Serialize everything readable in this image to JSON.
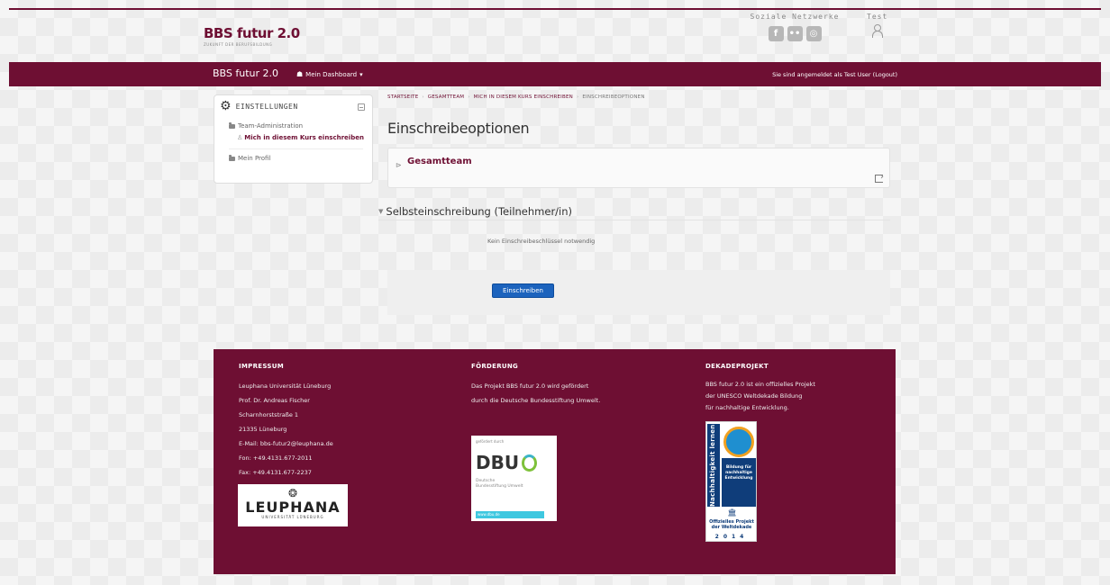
{
  "header": {
    "brand": "BBS futur 2.0",
    "brand_sub": "ZUKUNFT DER BERUFSBILDUNG",
    "social_title": "Soziale Netzwerke",
    "social_icons": [
      "f",
      "••",
      "◎"
    ],
    "user_label": "Test"
  },
  "navbar": {
    "brand": "BBS futur 2.0",
    "dashboard": "Mein Dashboard",
    "logged_in": "Sie sind angemeldet als Test User",
    "logout": "(Logout)"
  },
  "settings": {
    "title": "EINSTELLUNGEN",
    "team_admin": "Team-Administration",
    "enrol_self": "Mich in diesem Kurs einschreiben",
    "profile": "Mein Profil"
  },
  "breadcrumb": [
    "STARTSEITE",
    "GESAMTTEAM",
    "MICH IN DIESEM KURS EINSCHREIBEN",
    "EINSCHREIBEOPTIONEN"
  ],
  "page": {
    "title": "Einschreibeoptionen",
    "course": "Gesamtteam",
    "section": "Selbsteinschreibung (Teilnehmer/in)",
    "no_key": "Kein Einschreibeschlüssel notwendig",
    "submit": "Einschreiben"
  },
  "footer": {
    "impressum": {
      "title": "IMPRESSUM",
      "lines": [
        "Leuphana Universität Lüneburg",
        "Prof. Dr. Andreas Fischer",
        "Scharnhorststraße 1",
        "21335 Lüneburg",
        "E-Mail:   bbs-futur2@leuphana.de",
        "Fon:      +49.4131.677-2011",
        "Fax:      +49.4131.677-2237"
      ],
      "logo_name": "LEUPHANA",
      "logo_sub": "UNIVERSITÄT LÜNEBURG"
    },
    "foerderung": {
      "title": "FÖRDERUNG",
      "lines": [
        "Das Projekt BBS futur 2.0 wird gefördert",
        "durch die Deutsche Bundesstiftung Umwelt."
      ],
      "logo_top": "gefördert durch",
      "logo_name": "DBU",
      "logo_sub1": "Deutsche",
      "logo_sub2": "Bundesstiftung Umwelt",
      "logo_url": "www.dbu.de"
    },
    "dekade": {
      "title": "DEKADEPROJEKT",
      "lines": [
        "BBS futur 2.0 ist ein offizielles Projekt",
        "der UNESCO Weltdekade Bildung",
        "für nachhaltige Entwicklung."
      ],
      "logo_vertical": "Nachhaltigkeit lernen",
      "logo_block": "Bildung für nachhaltige Entwicklung",
      "logo_org": "UNESCO",
      "logo_bottom": "Offizielles Projekt der Weltdekade",
      "logo_years": "2014"
    }
  },
  "colors": {
    "brand": "#6e0f33",
    "button": "#1c63bd"
  }
}
